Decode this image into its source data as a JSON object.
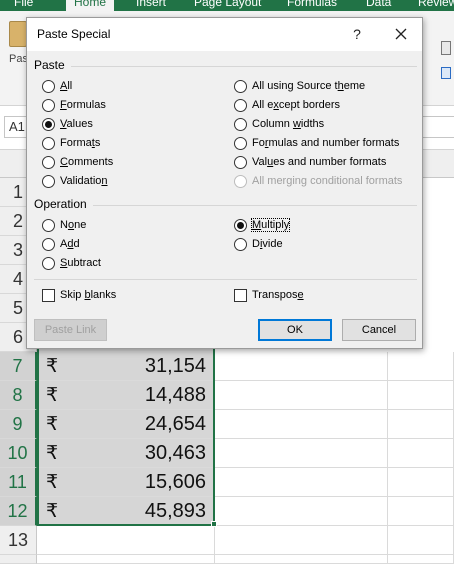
{
  "ribbon": {
    "tabs": [
      "File",
      "Home",
      "Insert",
      "Page Layout",
      "Formulas",
      "Data",
      "Review"
    ],
    "active_tab": "Home",
    "paste_label": "Pas"
  },
  "formula_bar": {
    "namebox": "A1"
  },
  "grid": {
    "row_numbers": [
      "1",
      "2",
      "3",
      "4",
      "5",
      "6",
      "7",
      "8",
      "9",
      "10",
      "11",
      "12",
      "13"
    ],
    "rows": [
      {
        "currency": "₹",
        "value": "31,154"
      },
      {
        "currency": "₹",
        "value": "14,488"
      },
      {
        "currency": "₹",
        "value": "24,654"
      },
      {
        "currency": "₹",
        "value": "30,463"
      },
      {
        "currency": "₹",
        "value": "15,606"
      },
      {
        "currency": "₹",
        "value": "45,893"
      }
    ]
  },
  "dialog": {
    "title": "Paste Special",
    "help": "?",
    "paste_group": {
      "label": "Paste",
      "left": [
        {
          "pre": "",
          "key": "A",
          "post": "ll",
          "selected": false,
          "enabled": true
        },
        {
          "pre": "",
          "key": "F",
          "post": "ormulas",
          "selected": false,
          "enabled": true
        },
        {
          "pre": "",
          "key": "V",
          "post": "alues",
          "selected": true,
          "enabled": true
        },
        {
          "pre": "Forma",
          "key": "t",
          "post": "s",
          "selected": false,
          "enabled": true
        },
        {
          "pre": "",
          "key": "C",
          "post": "omments",
          "selected": false,
          "enabled": true
        },
        {
          "pre": "Validatio",
          "key": "n",
          "post": "",
          "selected": false,
          "enabled": true
        }
      ],
      "right": [
        {
          "pre": "All using Source t",
          "key": "h",
          "post": "eme",
          "selected": false,
          "enabled": true
        },
        {
          "pre": "All e",
          "key": "x",
          "post": "cept borders",
          "selected": false,
          "enabled": true
        },
        {
          "pre": "Column ",
          "key": "w",
          "post": "idths",
          "selected": false,
          "enabled": true
        },
        {
          "pre": "Fo",
          "key": "r",
          "post": "mulas and number formats",
          "selected": false,
          "enabled": true
        },
        {
          "pre": "Val",
          "key": "u",
          "post": "es and number formats",
          "selected": false,
          "enabled": true
        },
        {
          "pre": "All merging conditional formats",
          "key": "",
          "post": "",
          "selected": false,
          "enabled": false
        }
      ]
    },
    "operation_group": {
      "label": "Operation",
      "left": [
        {
          "pre": "N",
          "key": "o",
          "post": "ne",
          "selected": false
        },
        {
          "pre": "A",
          "key": "d",
          "post": "d",
          "selected": false
        },
        {
          "pre": "",
          "key": "S",
          "post": "ubtract",
          "selected": false
        }
      ],
      "right": [
        {
          "pre": "",
          "key": "M",
          "post": "ultiply",
          "selected": true
        },
        {
          "pre": "D",
          "key": "i",
          "post": "vide",
          "selected": false
        }
      ]
    },
    "skip_blanks": {
      "pre": "Skip ",
      "key": "b",
      "post": "lanks",
      "checked": false
    },
    "transpose": {
      "pre": "Transpos",
      "key": "e",
      "post": "",
      "checked": false
    },
    "buttons": {
      "paste_link": "Paste Link",
      "ok": "OK",
      "cancel": "Cancel"
    }
  }
}
